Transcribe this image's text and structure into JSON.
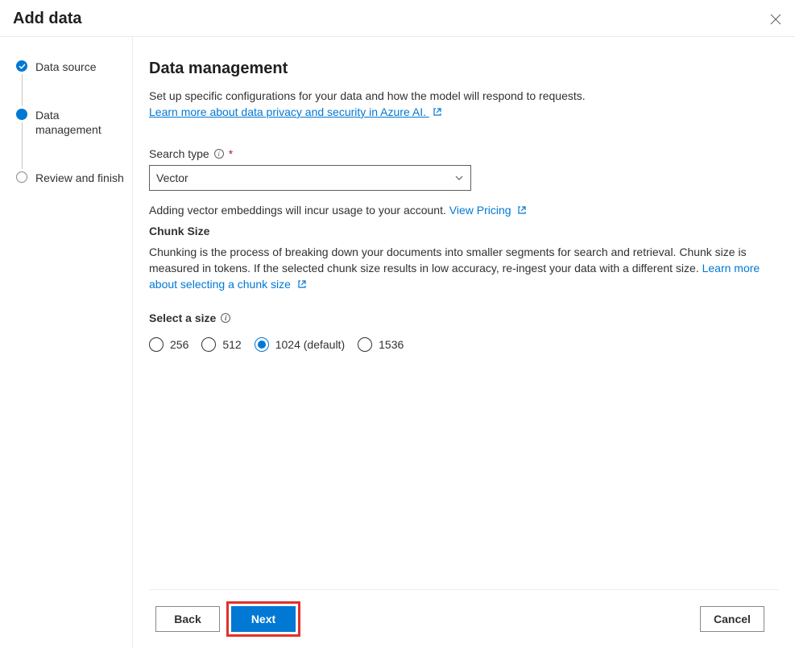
{
  "dialog": {
    "title": "Add data"
  },
  "steps": {
    "items": [
      {
        "label": "Data source",
        "state": "done"
      },
      {
        "label": "Data management",
        "state": "current"
      },
      {
        "label": "Review and finish",
        "state": "upcoming"
      }
    ]
  },
  "page": {
    "title": "Data management",
    "description": "Set up specific configurations for your data and how the model will respond to requests.",
    "learn_more_link": "Learn more about data privacy and security in Azure AI."
  },
  "search_type": {
    "label": "Search type",
    "selected": "Vector",
    "hint_prefix": "Adding vector embeddings will incur usage to your account. ",
    "pricing_link": "View Pricing"
  },
  "chunk": {
    "heading": "Chunk Size",
    "body": "Chunking is the process of breaking down your documents into smaller segments for search and retrieval. Chunk size is measured in tokens. If the selected chunk size results in low accuracy, re-ingest your data with a different size.",
    "learn_link": "Learn more about selecting a chunk size",
    "select_label": "Select a size",
    "options": [
      {
        "label": "256",
        "selected": false
      },
      {
        "label": "512",
        "selected": false
      },
      {
        "label": "1024 (default)",
        "selected": true
      },
      {
        "label": "1536",
        "selected": false
      }
    ]
  },
  "footer": {
    "back": "Back",
    "next": "Next",
    "cancel": "Cancel"
  }
}
